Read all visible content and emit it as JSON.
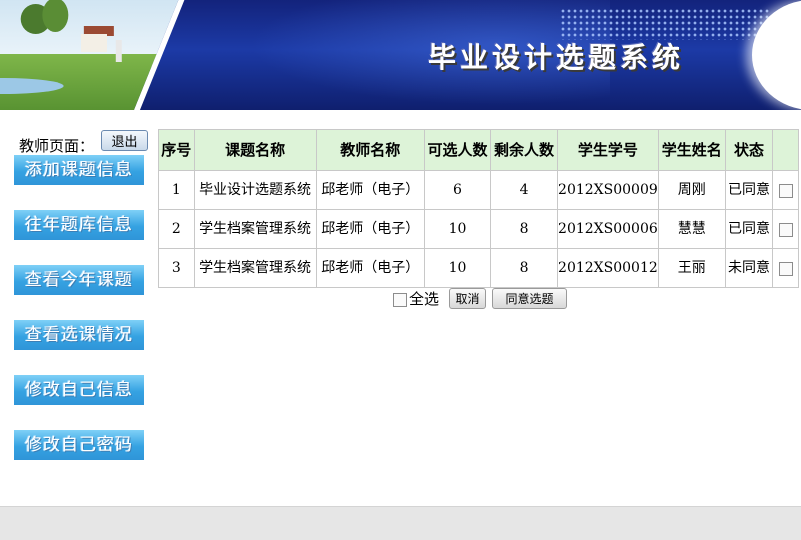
{
  "header": {
    "title": "毕业设计选题系统"
  },
  "sidebar": {
    "teacher_label": "教师页面：",
    "logout_label": "退出",
    "items": [
      {
        "label": "添加课题信息"
      },
      {
        "label": "往年题库信息"
      },
      {
        "label": "查看今年课题"
      },
      {
        "label": "查看选课情况"
      },
      {
        "label": "修改自己信息"
      },
      {
        "label": "修改自己密码"
      }
    ]
  },
  "table": {
    "headers": [
      "序号",
      "课题名称",
      "教师名称",
      "可选人数",
      "剩余人数",
      "学生学号",
      "学生姓名",
      "状态",
      ""
    ],
    "rows": [
      {
        "no": "1",
        "topic": "毕业设计选题系统",
        "teacher": "邱老师（电子）",
        "available": "6",
        "remaining": "4",
        "student_id": "2012XS00009",
        "student_name": "周刚",
        "status": "已同意",
        "checked": false
      },
      {
        "no": "2",
        "topic": "学生档案管理系统",
        "teacher": "邱老师（电子）",
        "available": "10",
        "remaining": "8",
        "student_id": "2012XS00006",
        "student_name": "慧慧",
        "status": "已同意",
        "checked": false
      },
      {
        "no": "3",
        "topic": "学生档案管理系统",
        "teacher": "邱老师（电子）",
        "available": "10",
        "remaining": "8",
        "student_id": "2012XS00012",
        "student_name": "王丽",
        "status": "未同意",
        "checked": false
      }
    ]
  },
  "actions": {
    "select_all_label": "全选",
    "cancel_label": "取消",
    "agree_label": "同意选题"
  }
}
